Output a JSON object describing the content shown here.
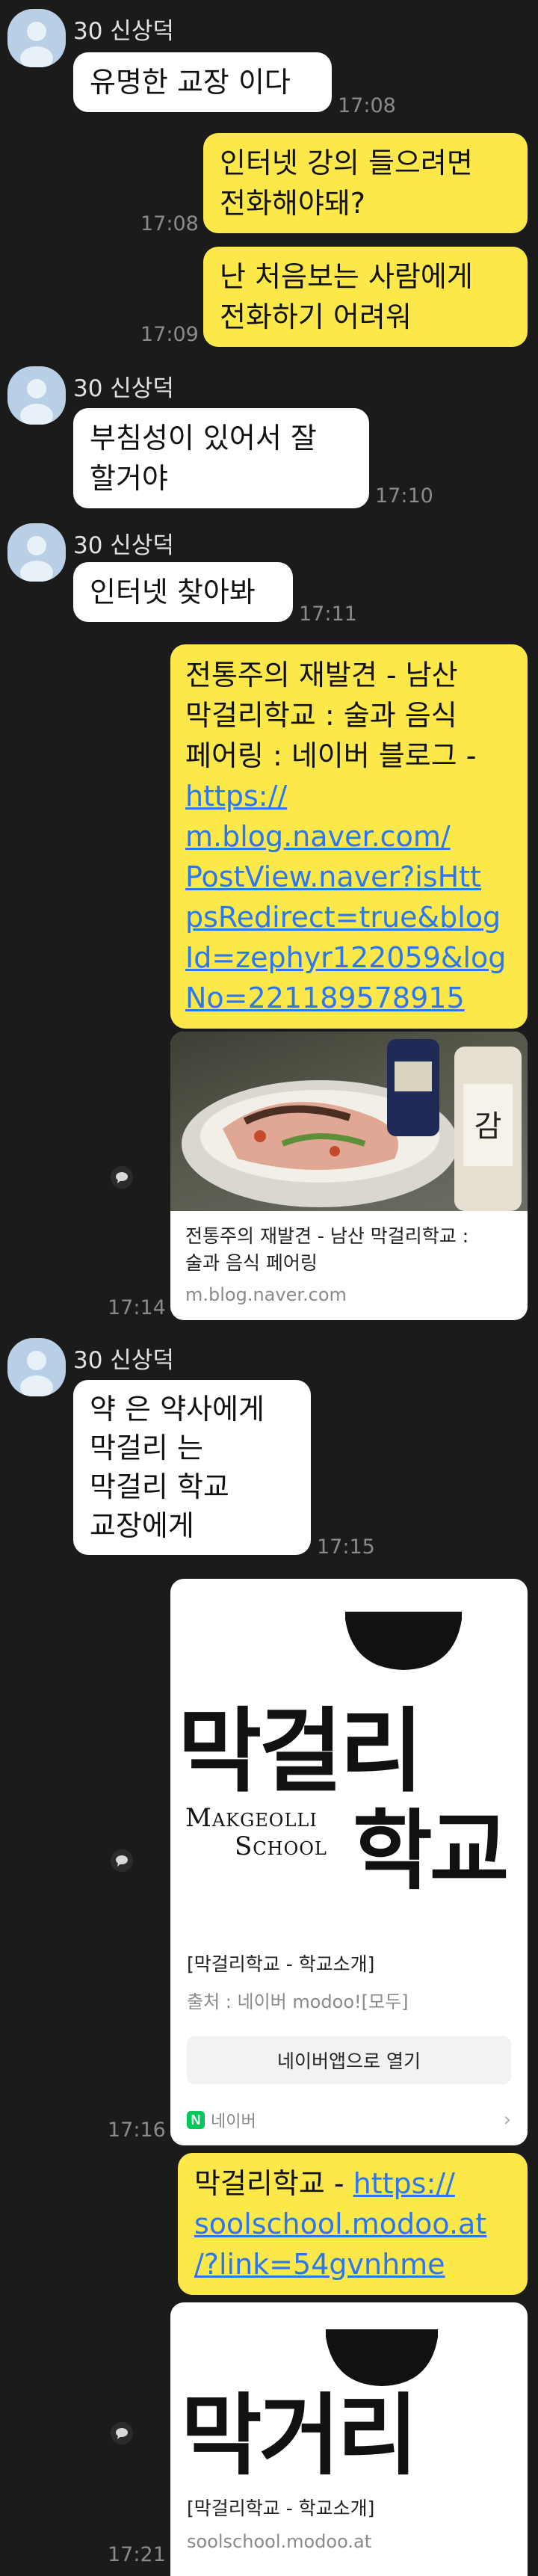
{
  "sender": "30 신상덕",
  "messages": {
    "m1": {
      "text": "유명한 교장 이다",
      "time": "17:08"
    },
    "m2": {
      "line1": "인터넷 강의 들으려면",
      "line2": "전화해야돼?",
      "time": "17:08"
    },
    "m3": {
      "line1": "난 처음보는 사람에게",
      "line2": "전화하기 어려워",
      "time": "17:09"
    },
    "m4": {
      "line1": "부침성이 있어서 잘",
      "line2": "할거야",
      "time": "17:10"
    },
    "m5": {
      "text": "인터넷 찾아봐",
      "time": "17:11"
    },
    "m6": {
      "lines": [
        "전통주의 재발견 - 남산",
        "막걸리학교 : 술과 음식",
        "페어링 : 네이버 블로그 -"
      ],
      "link_lines": [
        "https://",
        "m.blog.naver.com/",
        "PostView.naver?isHtt",
        "psRedirect=true&blog",
        "Id=zephyr122059&log",
        "No=221189578915"
      ]
    },
    "card1": {
      "title_line1": "전통주의 재발견 - 남산 막걸리학교 :",
      "title_line2": "술과 음식 페어링",
      "domain": "m.blog.naver.com",
      "time": "17:14"
    },
    "m7": {
      "lines": [
        "약 은 약사에게",
        "막걸리 는",
        "막걸리 학교",
        "교장에게"
      ],
      "time": "17:15"
    },
    "card2": {
      "logo_korean_1": "막걸리",
      "logo_korean_2": "학교",
      "logo_english_1": "Makgeolli",
      "logo_english_2": "School",
      "title": "[막걸리학교 - 학교소개]",
      "source": "출처 : 네이버 modoo![모두]",
      "open_button": "네이버앱으로 열기",
      "footer_label": "네이버",
      "time": "17:16"
    },
    "m8": {
      "prefix": "막걸리학교 - ",
      "link_lines": [
        "https://",
        "soolschool.modoo.at",
        "/?link=54gvnhme"
      ]
    },
    "card3": {
      "logo_korean": "막거리",
      "title": "[막걸리학교 - 학교소개]",
      "domain": "soolschool.modoo.at",
      "time": "17:21"
    }
  },
  "colors": {
    "background": "#1b1b1b",
    "outgoing": "#fde84a",
    "incoming": "#ffffff",
    "link": "#2a77f0",
    "naver_green": "#03c75a"
  }
}
